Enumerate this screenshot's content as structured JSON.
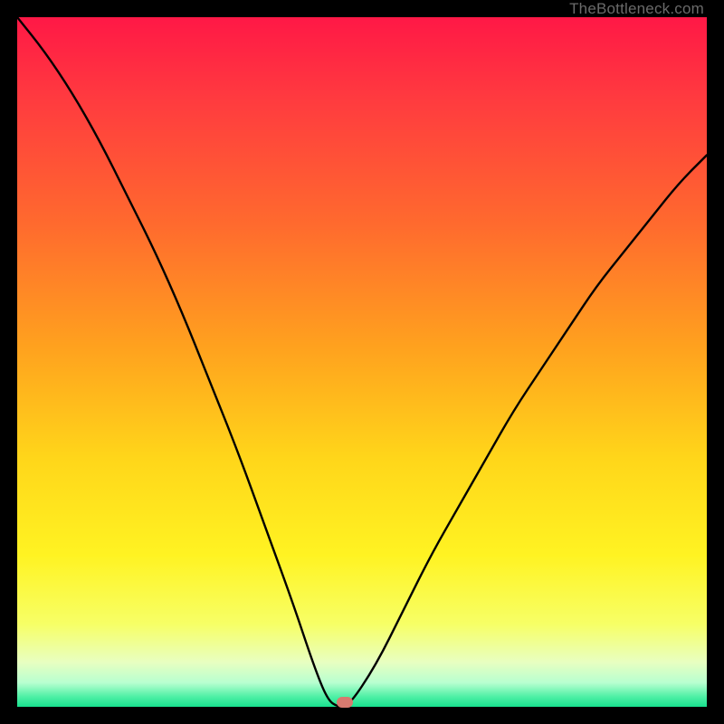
{
  "watermark": "TheBottleneck.com",
  "colors": {
    "frame": "#000000",
    "curve_stroke": "#000000",
    "marker_fill": "#d87a6f",
    "gradient_stops": [
      {
        "offset": 0.0,
        "color": "#ff1846"
      },
      {
        "offset": 0.12,
        "color": "#ff3b3f"
      },
      {
        "offset": 0.3,
        "color": "#ff6a2e"
      },
      {
        "offset": 0.48,
        "color": "#ffa21e"
      },
      {
        "offset": 0.64,
        "color": "#ffd61a"
      },
      {
        "offset": 0.78,
        "color": "#fff322"
      },
      {
        "offset": 0.88,
        "color": "#f7ff66"
      },
      {
        "offset": 0.935,
        "color": "#e8ffc0"
      },
      {
        "offset": 0.965,
        "color": "#b8ffd0"
      },
      {
        "offset": 0.985,
        "color": "#50f0a6"
      },
      {
        "offset": 1.0,
        "color": "#18e08e"
      }
    ]
  },
  "chart_data": {
    "type": "line",
    "title": "",
    "xlabel": "",
    "ylabel": "",
    "xlim": [
      0,
      100
    ],
    "ylim": [
      0,
      100
    ],
    "series": [
      {
        "name": "bottleneck-curve",
        "x": [
          0,
          4,
          8,
          12,
          16,
          20,
          24,
          28,
          32,
          36,
          40,
          43,
          45,
          46.5,
          48,
          52,
          56,
          60,
          64,
          68,
          72,
          76,
          80,
          84,
          88,
          92,
          96,
          100
        ],
        "values": [
          100,
          95,
          89,
          82,
          74,
          66,
          57,
          47,
          37,
          26,
          15,
          6,
          1,
          0,
          0,
          6,
          14,
          22,
          29,
          36,
          43,
          49,
          55,
          61,
          66,
          71,
          76,
          80
        ]
      }
    ],
    "marker": {
      "x": 47.5,
      "y": 0.6
    }
  }
}
